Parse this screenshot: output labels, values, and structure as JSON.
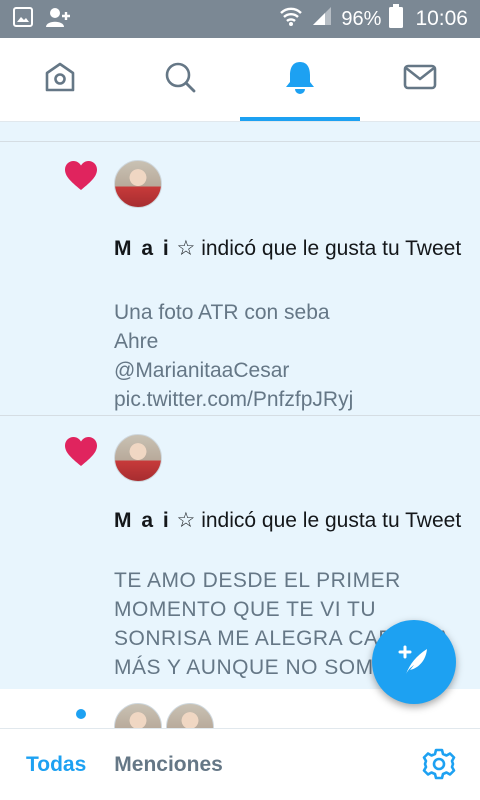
{
  "status_bar": {
    "battery": "96%",
    "time": "10:06"
  },
  "top_tabs": [
    {
      "name": "home",
      "icon": "home-icon"
    },
    {
      "name": "search",
      "icon": "search-icon"
    },
    {
      "name": "notifications",
      "icon": "bell-icon",
      "active": true
    },
    {
      "name": "messages",
      "icon": "mail-icon"
    }
  ],
  "notifications": [
    {
      "user": "M a i",
      "star": "☆",
      "action_text": "indicó que le gusta tu Tweet",
      "tweet_lines": [
        "Una foto ATR con seba",
        "Ahre",
        "@MarianitaaCesar",
        "pic.twitter.com/PnfzfpJRyj"
      ]
    },
    {
      "user": "M a i",
      "star": "☆",
      "action_text": "indicó que le gusta tu Tweet",
      "tweet_lines": [
        "TE AMO DESDE EL PRIMER",
        "MOMENTO QUE TE VI TU",
        "SONRISA ME ALEGRA CADA DÍA",
        "MÁS Y AUNQUE  NO SOM"
      ]
    }
  ],
  "bottom_tabs": {
    "all": "Todas",
    "mentions": "Menciones"
  },
  "colors": {
    "accent": "#1da1f2",
    "heart": "#e0245e",
    "status_bar": "#7b8894",
    "unread_bg": "#e8f5fd"
  }
}
